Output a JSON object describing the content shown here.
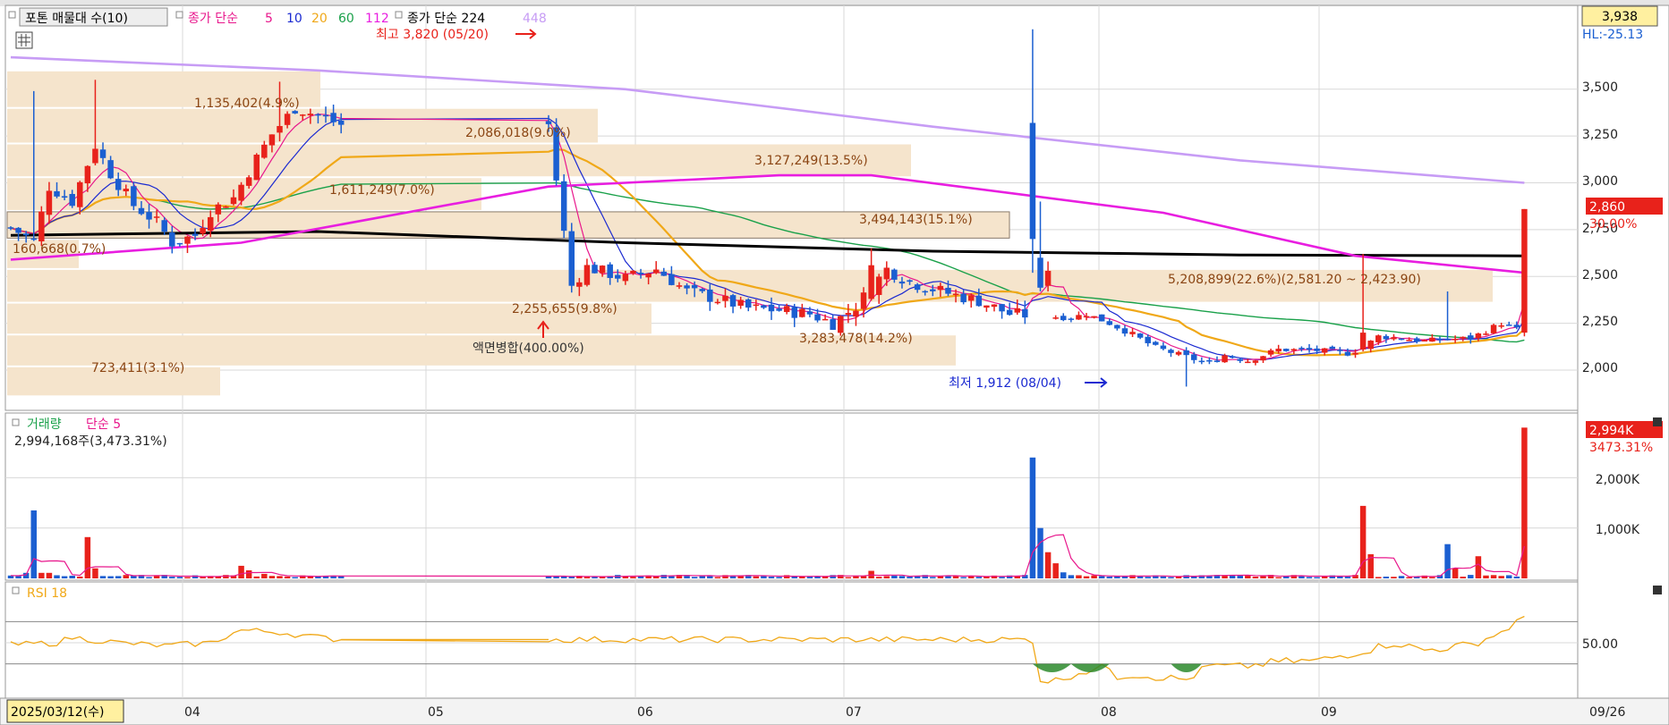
{
  "price_panel": {
    "legend": {
      "vp_label": "포톤 매물대 수(10)",
      "ma_prefix": "종가 단순",
      "ma_periods": [
        "5",
        "10",
        "20",
        "60",
        "112"
      ],
      "ma2_prefix": "종가 단순 224",
      "ma2_period": "448"
    },
    "high_marker": "최고 3,820 (05/20)",
    "low_marker": "최저 1,912 (08/04)",
    "split_label": "액면병합(400.00%)",
    "axis_ticks": [
      "3,500",
      "3,250",
      "3,000",
      "2,750",
      "2,500",
      "2,250",
      "2,000"
    ],
    "top_value": "3,938",
    "hl_label": "HL:-25.13",
    "last_price": "2,860",
    "last_change": "30.00%",
    "volume_profile": [
      "1,135,402(4.9%)",
      "2,086,018(9.0%)",
      "3,127,249(13.5%)",
      "1,611,249(7.0%)",
      "3,494,143(15.1%)",
      "160,668(0.7%)",
      "5,208,899(22.6%)(2,581.20 ~ 2,423.90)",
      "2,255,655(9.8%)",
      "3,283,478(14.2%)",
      "723,411(3.1%)"
    ]
  },
  "volume_panel": {
    "legend_label": "거래량",
    "legend_ma": "단순 5",
    "summary": "2,994,168주(3,473.31%)",
    "axis_ticks": [
      "2,000K",
      "1,000K"
    ],
    "last_value": "2,994K",
    "last_change": "3473.31%"
  },
  "rsi_panel": {
    "legend_label": "RSI 18",
    "axis_tick": "50.00"
  },
  "x_axis": {
    "start_date": "2025/03/12(수)",
    "months": [
      "04",
      "05",
      "06",
      "07",
      "08",
      "09"
    ],
    "end_label": "09/26"
  },
  "colors": {
    "up": "#e8221b",
    "down": "#1b5fd1",
    "ma5": "#e8178c",
    "ma10": "#1b2ad1",
    "ma20": "#f0a818",
    "ma60": "#1aa14a",
    "ma112": "#e81ee0",
    "ma224": "#000000",
    "ma448": "#c79cf5",
    "vp_band": "#f5e4cc",
    "vp_text": "#8b4513",
    "grid": "#d8d8d8",
    "rsi": "#f0a818"
  },
  "chart_data": [
    {
      "type": "candlestick",
      "title": "",
      "ylim": [
        1900,
        3938
      ],
      "x": [
        "03/12",
        "04/01",
        "05/02",
        "06/02",
        "07/01",
        "08/01",
        "09/01",
        "09/26"
      ],
      "open": [
        2700,
        2950,
        2700,
        2400,
        2500,
        2090,
        2110,
        2200
      ],
      "high": [
        2800,
        3100,
        3500,
        2700,
        2600,
        2200,
        2200,
        2860
      ],
      "low": [
        2650,
        2650,
        2550,
        2180,
        2300,
        1912,
        2050,
        2180
      ],
      "close": [
        2750,
        2700,
        3300,
        2400,
        2320,
        2100,
        2150,
        2860
      ],
      "annotations": {
        "high": 3820,
        "high_date": "05/20",
        "low": 1912,
        "low_date": "08/04",
        "split": "05/20"
      }
    },
    {
      "type": "bar",
      "title": "",
      "x": [
        "03/12",
        "03/15",
        "04/01",
        "04/22",
        "05/20",
        "05/21",
        "06/05",
        "06/25",
        "08/26",
        "09/18",
        "09/22",
        "09/26"
      ],
      "values": [
        70000,
        1350000,
        40000,
        260000,
        2400000,
        1000000,
        50000,
        80000,
        1440000,
        680000,
        440000,
        2994168
      ],
      "ylim": [
        0,
        3000000
      ]
    },
    {
      "type": "line",
      "title": "",
      "x": [
        "03/12",
        "04/01",
        "04/20",
        "05/20",
        "05/21",
        "06/01",
        "07/01",
        "08/04",
        "08/20",
        "09/01",
        "09/20",
        "09/26"
      ],
      "values": [
        50,
        47,
        60,
        55,
        15,
        18,
        30,
        15,
        28,
        45,
        48,
        73
      ],
      "ylim": [
        0,
        100
      ]
    }
  ]
}
